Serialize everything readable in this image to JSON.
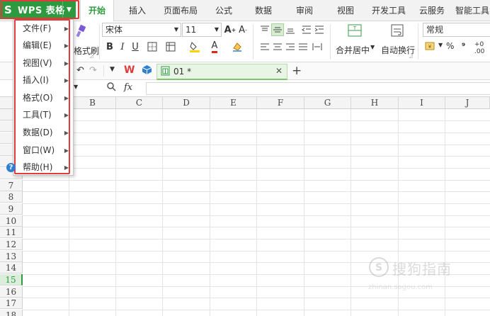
{
  "app": {
    "title": "WPS 表格",
    "brand_color": "#2e9a3f",
    "highlight_color": "#e23b3b"
  },
  "tabs": [
    {
      "label": "开始",
      "active": true
    },
    {
      "label": "插入"
    },
    {
      "label": "页面布局"
    },
    {
      "label": "公式"
    },
    {
      "label": "数据"
    },
    {
      "label": "审阅"
    },
    {
      "label": "视图"
    },
    {
      "label": "开发工具"
    },
    {
      "label": "云服务"
    },
    {
      "label": "智能工具"
    }
  ],
  "ribbon": {
    "format_painter_label": "格式刷",
    "font_name": "宋体",
    "font_size": "11",
    "merge_center_label": "合并居中",
    "wrap_text_label": "自动换行",
    "number_format": "常规",
    "percent_symbol": "%",
    "thousands_symbol": "⁹"
  },
  "document_tab": {
    "name": "01 *"
  },
  "formula_bar": {
    "fx_label": "fx",
    "value": ""
  },
  "menu": {
    "items": [
      {
        "label": "文件(F)"
      },
      {
        "label": "编辑(E)"
      },
      {
        "label": "视图(V)"
      },
      {
        "label": "插入(I)"
      },
      {
        "label": "格式(O)"
      },
      {
        "label": "工具(T)"
      },
      {
        "label": "数据(D)"
      },
      {
        "label": "窗口(W)"
      },
      {
        "label": "帮助(H)"
      }
    ]
  },
  "grid": {
    "columns": [
      "B",
      "C",
      "D",
      "E",
      "F",
      "G",
      "H",
      "I",
      "J"
    ],
    "rows": [
      "7",
      "8",
      "9",
      "10",
      "11",
      "12",
      "13",
      "14",
      "15",
      "16",
      "17",
      "18"
    ],
    "selected_row": "15"
  },
  "watermark": {
    "text": "搜狗指南",
    "subtext": "zhinan.sogou.com"
  }
}
